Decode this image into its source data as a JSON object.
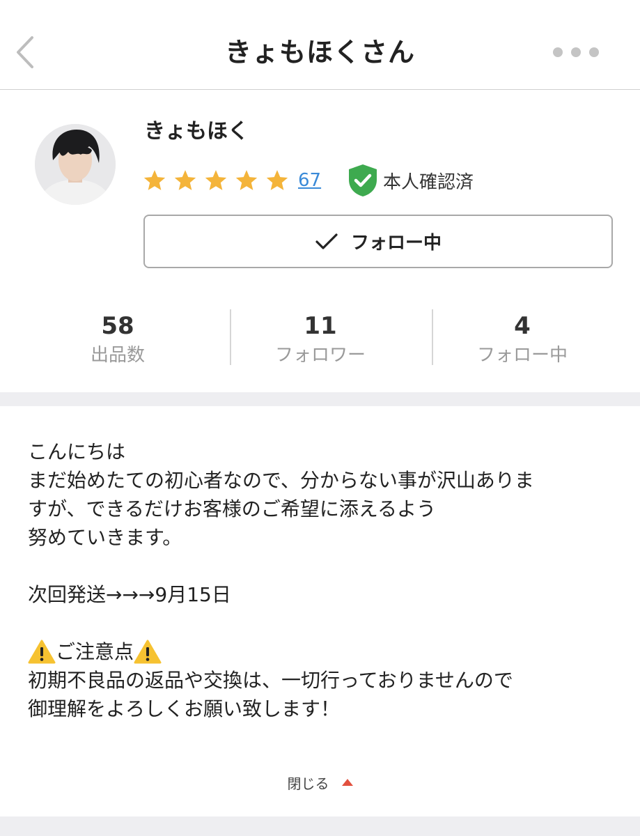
{
  "header": {
    "title": "きょもほくさん"
  },
  "profile": {
    "name": "きょもほく",
    "rating": 5,
    "review_count": "67",
    "verified_label": "本人確認済",
    "follow_button_label": "フォロー中"
  },
  "stats": [
    {
      "value": "58",
      "label": "出品数"
    },
    {
      "value": "11",
      "label": "フォロワー"
    },
    {
      "value": "4",
      "label": "フォロー中"
    }
  ],
  "bio": {
    "greeting": "こんにちは",
    "intro_line1": "まだ始めたての初心者なので、分からない事が沢山ありま",
    "intro_line2": "すが、できるだけお客様のご希望に添えるよう",
    "intro_line3": "努めていきます。",
    "shipping": "次回発送→→→9月15日",
    "notice_title": "ご注意点",
    "notice_line1": "初期不良品の返品や交換は、一切行っておりませんので",
    "notice_line2": "御理解をよろしくお願い致します！"
  },
  "close_label": "閉じる",
  "colors": {
    "star": "#f4b43a",
    "link": "#3a8ad8",
    "verified": "#3eaa4f",
    "warning": "#f6c231",
    "caret": "#e2513f",
    "band": "#eeeef1"
  }
}
